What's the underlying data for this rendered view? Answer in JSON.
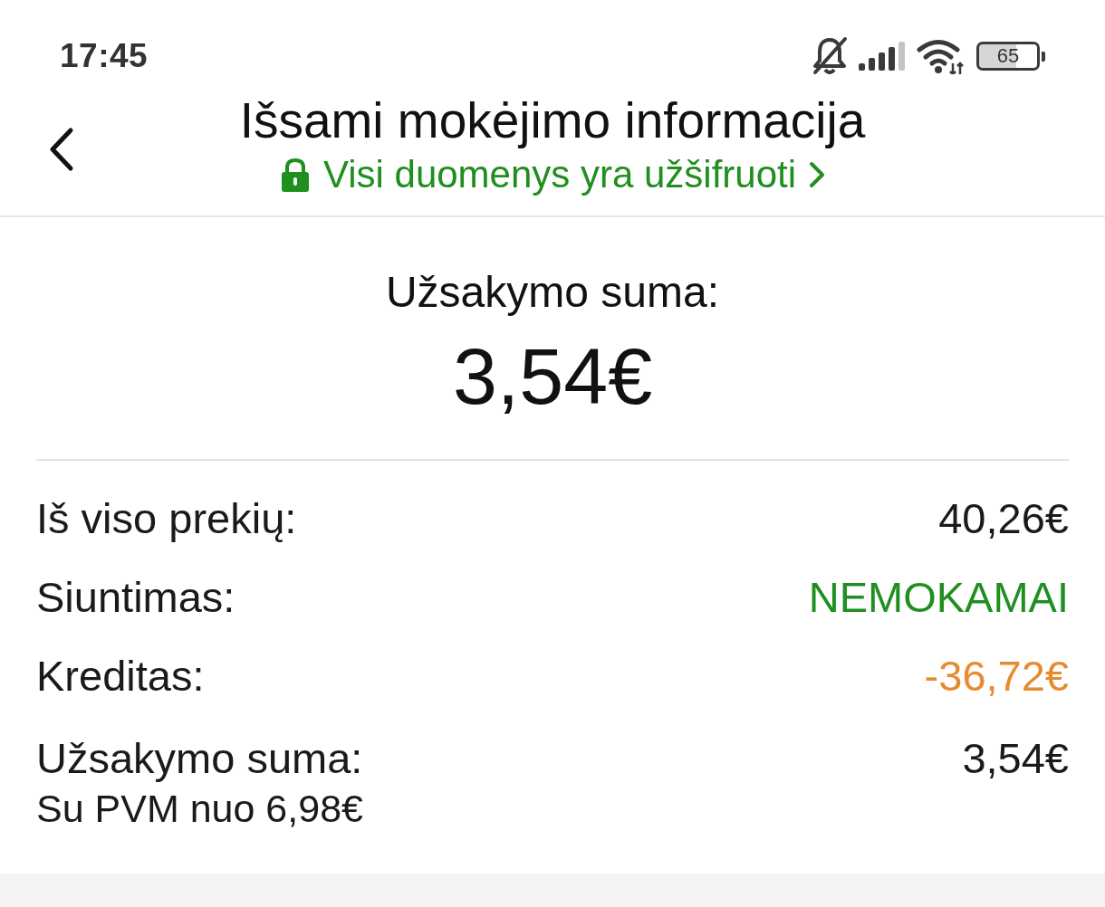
{
  "status_bar": {
    "time": "17:45",
    "battery": "65"
  },
  "header": {
    "title": "Išsami mokėjimo informacija",
    "security_link": "Visi duomenys yra užšifruoti"
  },
  "summary": {
    "label": "Užsakymo suma:",
    "amount": "3,54€"
  },
  "breakdown": [
    {
      "label": "Iš viso prekių:",
      "value": "40,26€",
      "color": "#1a1a1a"
    },
    {
      "label": "Siuntimas:",
      "value": "NEMOKAMAI",
      "color": "#1f8f1f"
    },
    {
      "label": "Kreditas:",
      "value": "-36,72€",
      "color": "#e88a2e"
    },
    {
      "label": "Užsakymo suma:",
      "note": "Su PVM nuo 6,98€",
      "value": "3,54€",
      "color": "#1a1a1a"
    }
  ]
}
